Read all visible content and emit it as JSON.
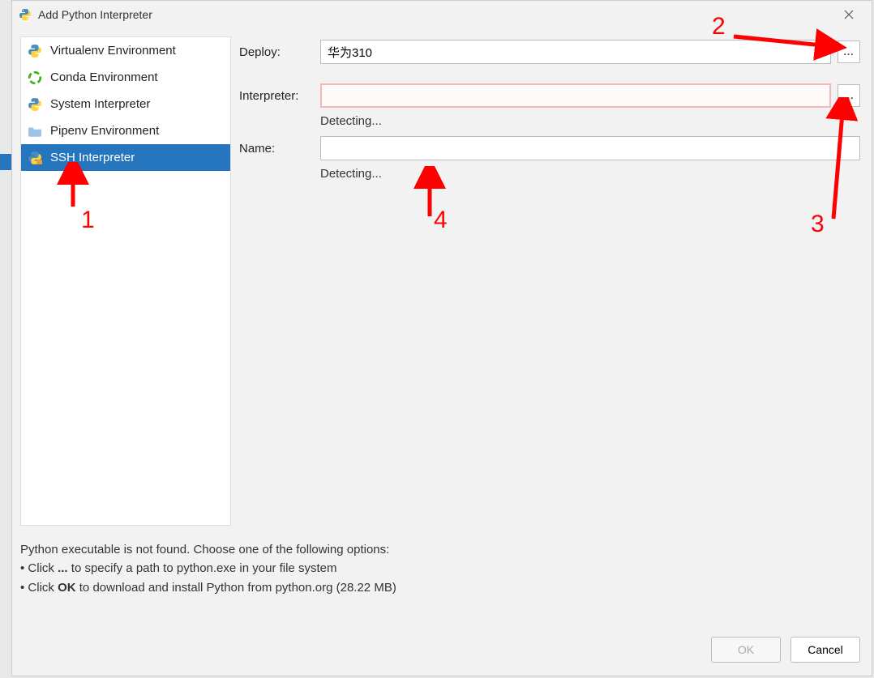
{
  "title": "Add Python Interpreter",
  "sidebar": {
    "items": [
      {
        "label": "Virtualenv Environment"
      },
      {
        "label": "Conda Environment"
      },
      {
        "label": "System Interpreter"
      },
      {
        "label": "Pipenv Environment"
      },
      {
        "label": "SSH Interpreter"
      }
    ]
  },
  "form": {
    "deploy_label": "Deploy:",
    "deploy_value": "华为310",
    "interpreter_label": "Interpreter:",
    "interpreter_value": "",
    "interpreter_status": "Detecting...",
    "name_label": "Name:",
    "name_value": "",
    "name_status": "Detecting...",
    "browse_label": "..."
  },
  "info": {
    "line1": "Python executable is not found. Choose one of the following options:",
    "line2_prefix": "• Click ",
    "line2_bold": "...",
    "line2_suffix": " to specify a path to python.exe in your file system",
    "line3_prefix": "• Click ",
    "line3_bold": "OK",
    "line3_suffix": " to download and install Python from python.org (28.22 MB)"
  },
  "buttons": {
    "ok": "OK",
    "cancel": "Cancel"
  },
  "annotations": {
    "n1": "1",
    "n2": "2",
    "n3": "3",
    "n4": "4"
  }
}
